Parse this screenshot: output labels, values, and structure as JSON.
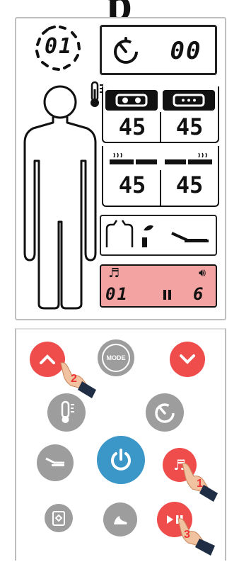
{
  "title": "p",
  "display": {
    "program_number": "01",
    "timer_value": "00",
    "temperature_icon": "thermometer-icon",
    "zones": [
      {
        "icon": "upper-airbag-icon",
        "value": "45"
      },
      {
        "icon": "lower-airbag-icon",
        "value": "45"
      },
      {
        "icon": "heat-left-icon",
        "value": "45"
      },
      {
        "icon": "heat-right-icon",
        "value": "45"
      }
    ],
    "music": {
      "track": "01",
      "volume": "6",
      "note_icon": "music-note-icon",
      "speaker_icon": "speaker-icon",
      "pause_icon": "pause-icon",
      "bg_color": "#f4a3a3"
    }
  },
  "remote": {
    "mode_label": "MODE",
    "step_labels": {
      "up": "2",
      "music": "1",
      "play_pause": "3"
    },
    "colors": {
      "red": "#ef4c4c",
      "gray": "#9d9d9d",
      "blue": "#3a97c8"
    }
  }
}
